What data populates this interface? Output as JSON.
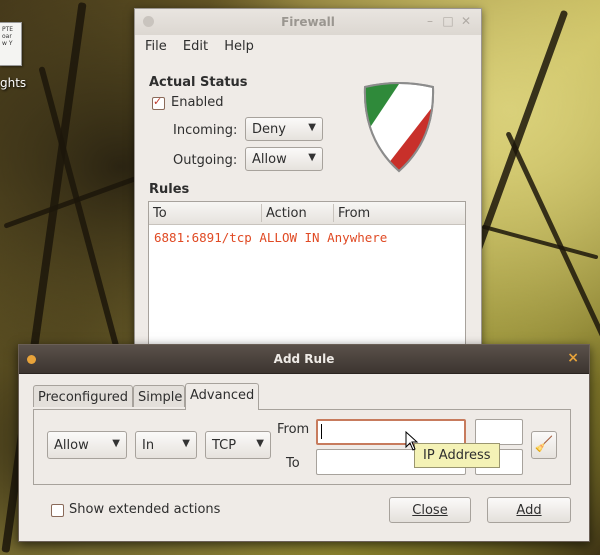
{
  "desktop": {
    "icon_text": [
      "PTE",
      "oar",
      "w Y"
    ],
    "icon_label": "ghts"
  },
  "firewall_window": {
    "title": "Firewall",
    "menu": [
      "File",
      "Edit",
      "Help"
    ],
    "status_heading": "Actual Status",
    "enabled_label": "Enabled",
    "enabled_checked": true,
    "incoming_label": "Incoming:",
    "incoming_value": "Deny",
    "outgoing_label": "Outgoing:",
    "outgoing_value": "Allow",
    "rules_heading": "Rules",
    "columns": [
      "To",
      "Action",
      "From"
    ],
    "rules": [
      {
        "to": "6881:6891/tcp",
        "action": "ALLOW IN",
        "from": "Anywhere"
      }
    ]
  },
  "add_rule_dialog": {
    "title": "Add Rule",
    "close_glyph": "×",
    "tabs": [
      "Preconfigured",
      "Simple",
      "Advanced"
    ],
    "active_tab": "Advanced",
    "action_value": "Allow",
    "direction_value": "In",
    "protocol_value": "TCP",
    "from_label": "From",
    "to_label": "To",
    "from_ip": "",
    "from_port": "",
    "to_ip": "",
    "to_port": "",
    "tooltip": "IP Address",
    "extended_label": "Show extended actions",
    "extended_checked": false,
    "close_button": "Close",
    "add_button": "Add"
  },
  "colors": {
    "rule_text": "#e04a24",
    "dialog_title_bg": "#3c3530",
    "accent_orange": "#e8a33a",
    "tooltip_bg": "#f4f2b6"
  }
}
